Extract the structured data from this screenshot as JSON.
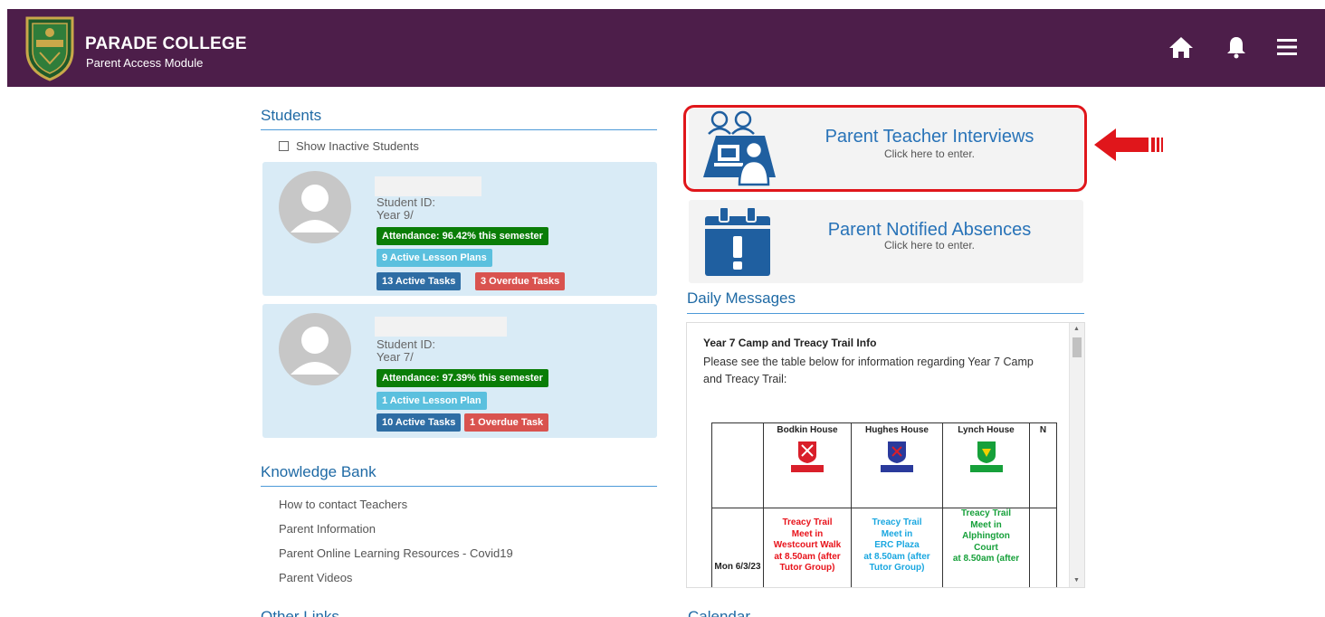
{
  "header": {
    "title": "PARADE COLLEGE",
    "subtitle": "Parent Access Module",
    "icons": [
      "home-icon",
      "bell-icon",
      "menu-icon"
    ]
  },
  "students_section": {
    "title": "Students",
    "show_inactive_label": "Show Inactive Students",
    "students": [
      {
        "id_label": "Student ID:",
        "year": "Year 9/",
        "attendance": "Attendance: 96.42% this semester",
        "lesson_plans": "9 Active Lesson Plans",
        "active_tasks": "13 Active Tasks",
        "overdue_tasks": "3 Overdue Tasks"
      },
      {
        "id_label": "Student ID:",
        "year": "Year 7/",
        "attendance": "Attendance: 97.39% this semester",
        "lesson_plans": "1 Active Lesson Plan",
        "active_tasks": "10 Active Tasks",
        "overdue_tasks": "1 Overdue Task"
      }
    ]
  },
  "knowledge_bank": {
    "title": "Knowledge Bank",
    "links": [
      "How to contact Teachers",
      "Parent Information",
      "Parent Online Learning Resources - Covid19",
      "Parent Videos"
    ]
  },
  "tiles": [
    {
      "title": "Parent Teacher Interviews",
      "subtitle": "Click here to enter."
    },
    {
      "title": "Parent Notified Absences",
      "subtitle": "Click here to enter."
    }
  ],
  "daily_messages": {
    "title": "Daily Messages",
    "message_title": "Year 7 Camp and Treacy Trail Info",
    "message_text": "Please see the table below for information regarding Year 7 Camp and Treacy Trail:",
    "table": {
      "houses": [
        "Bodkin House",
        "Hughes House",
        "Lynch House",
        "N"
      ],
      "date": "Mon 6/3/23",
      "entries": [
        {
          "line1": "Treacy Trail",
          "line2": "Meet in",
          "line3": "Westcourt Walk",
          "line4": "at 8.50am (after",
          "line5": "Tutor Group)",
          "color": "#e8131b"
        },
        {
          "line1": "Treacy Trail",
          "line2": "Meet in",
          "line3": "ERC Plaza",
          "line4": "at 8.50am (after",
          "line5": "Tutor Group)",
          "color": "#1aa7e0"
        },
        {
          "line1": "Treacy Trail",
          "line2": "Meet in",
          "line3": "Alphington",
          "line4": "Court",
          "line5": "at 8.50am (after",
          "color": "#16a03a"
        }
      ]
    }
  },
  "bottom_partial": {
    "left": "Other Links",
    "right": "Calendar"
  },
  "colors": {
    "header_bg": "#4d1e4a",
    "accent_blue": "#1f6aa5",
    "attendance_green": "#0a7d07",
    "lesson_cyan": "#5bc0de",
    "task_blue": "#2e6da4",
    "overdue_red": "#d9534f",
    "highlight_red": "#e0161b"
  }
}
